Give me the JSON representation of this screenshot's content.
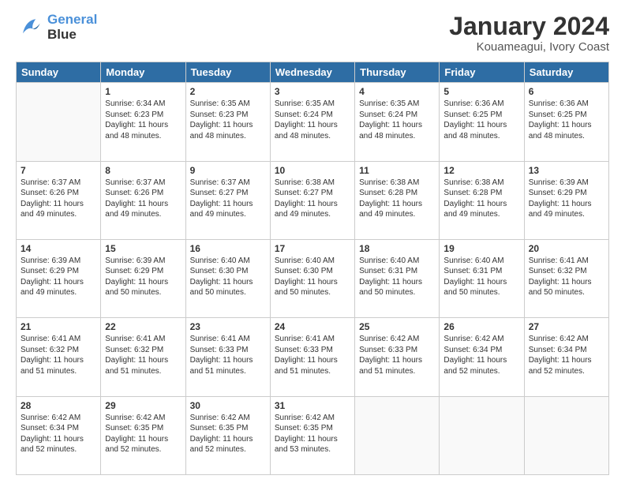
{
  "header": {
    "logo_line1": "General",
    "logo_line2": "Blue",
    "title": "January 2024",
    "subtitle": "Kouameagui, Ivory Coast"
  },
  "calendar": {
    "days_of_week": [
      "Sunday",
      "Monday",
      "Tuesday",
      "Wednesday",
      "Thursday",
      "Friday",
      "Saturday"
    ],
    "weeks": [
      [
        {
          "day": "",
          "info": ""
        },
        {
          "day": "1",
          "info": "Sunrise: 6:34 AM\nSunset: 6:23 PM\nDaylight: 11 hours\nand 48 minutes."
        },
        {
          "day": "2",
          "info": "Sunrise: 6:35 AM\nSunset: 6:23 PM\nDaylight: 11 hours\nand 48 minutes."
        },
        {
          "day": "3",
          "info": "Sunrise: 6:35 AM\nSunset: 6:24 PM\nDaylight: 11 hours\nand 48 minutes."
        },
        {
          "day": "4",
          "info": "Sunrise: 6:35 AM\nSunset: 6:24 PM\nDaylight: 11 hours\nand 48 minutes."
        },
        {
          "day": "5",
          "info": "Sunrise: 6:36 AM\nSunset: 6:25 PM\nDaylight: 11 hours\nand 48 minutes."
        },
        {
          "day": "6",
          "info": "Sunrise: 6:36 AM\nSunset: 6:25 PM\nDaylight: 11 hours\nand 48 minutes."
        }
      ],
      [
        {
          "day": "7",
          "info": "Sunrise: 6:37 AM\nSunset: 6:26 PM\nDaylight: 11 hours\nand 49 minutes."
        },
        {
          "day": "8",
          "info": "Sunrise: 6:37 AM\nSunset: 6:26 PM\nDaylight: 11 hours\nand 49 minutes."
        },
        {
          "day": "9",
          "info": "Sunrise: 6:37 AM\nSunset: 6:27 PM\nDaylight: 11 hours\nand 49 minutes."
        },
        {
          "day": "10",
          "info": "Sunrise: 6:38 AM\nSunset: 6:27 PM\nDaylight: 11 hours\nand 49 minutes."
        },
        {
          "day": "11",
          "info": "Sunrise: 6:38 AM\nSunset: 6:28 PM\nDaylight: 11 hours\nand 49 minutes."
        },
        {
          "day": "12",
          "info": "Sunrise: 6:38 AM\nSunset: 6:28 PM\nDaylight: 11 hours\nand 49 minutes."
        },
        {
          "day": "13",
          "info": "Sunrise: 6:39 AM\nSunset: 6:29 PM\nDaylight: 11 hours\nand 49 minutes."
        }
      ],
      [
        {
          "day": "14",
          "info": "Sunrise: 6:39 AM\nSunset: 6:29 PM\nDaylight: 11 hours\nand 49 minutes."
        },
        {
          "day": "15",
          "info": "Sunrise: 6:39 AM\nSunset: 6:29 PM\nDaylight: 11 hours\nand 50 minutes."
        },
        {
          "day": "16",
          "info": "Sunrise: 6:40 AM\nSunset: 6:30 PM\nDaylight: 11 hours\nand 50 minutes."
        },
        {
          "day": "17",
          "info": "Sunrise: 6:40 AM\nSunset: 6:30 PM\nDaylight: 11 hours\nand 50 minutes."
        },
        {
          "day": "18",
          "info": "Sunrise: 6:40 AM\nSunset: 6:31 PM\nDaylight: 11 hours\nand 50 minutes."
        },
        {
          "day": "19",
          "info": "Sunrise: 6:40 AM\nSunset: 6:31 PM\nDaylight: 11 hours\nand 50 minutes."
        },
        {
          "day": "20",
          "info": "Sunrise: 6:41 AM\nSunset: 6:32 PM\nDaylight: 11 hours\nand 50 minutes."
        }
      ],
      [
        {
          "day": "21",
          "info": "Sunrise: 6:41 AM\nSunset: 6:32 PM\nDaylight: 11 hours\nand 51 minutes."
        },
        {
          "day": "22",
          "info": "Sunrise: 6:41 AM\nSunset: 6:32 PM\nDaylight: 11 hours\nand 51 minutes."
        },
        {
          "day": "23",
          "info": "Sunrise: 6:41 AM\nSunset: 6:33 PM\nDaylight: 11 hours\nand 51 minutes."
        },
        {
          "day": "24",
          "info": "Sunrise: 6:41 AM\nSunset: 6:33 PM\nDaylight: 11 hours\nand 51 minutes."
        },
        {
          "day": "25",
          "info": "Sunrise: 6:42 AM\nSunset: 6:33 PM\nDaylight: 11 hours\nand 51 minutes."
        },
        {
          "day": "26",
          "info": "Sunrise: 6:42 AM\nSunset: 6:34 PM\nDaylight: 11 hours\nand 52 minutes."
        },
        {
          "day": "27",
          "info": "Sunrise: 6:42 AM\nSunset: 6:34 PM\nDaylight: 11 hours\nand 52 minutes."
        }
      ],
      [
        {
          "day": "28",
          "info": "Sunrise: 6:42 AM\nSunset: 6:34 PM\nDaylight: 11 hours\nand 52 minutes."
        },
        {
          "day": "29",
          "info": "Sunrise: 6:42 AM\nSunset: 6:35 PM\nDaylight: 11 hours\nand 52 minutes."
        },
        {
          "day": "30",
          "info": "Sunrise: 6:42 AM\nSunset: 6:35 PM\nDaylight: 11 hours\nand 52 minutes."
        },
        {
          "day": "31",
          "info": "Sunrise: 6:42 AM\nSunset: 6:35 PM\nDaylight: 11 hours\nand 53 minutes."
        },
        {
          "day": "",
          "info": ""
        },
        {
          "day": "",
          "info": ""
        },
        {
          "day": "",
          "info": ""
        }
      ]
    ]
  }
}
